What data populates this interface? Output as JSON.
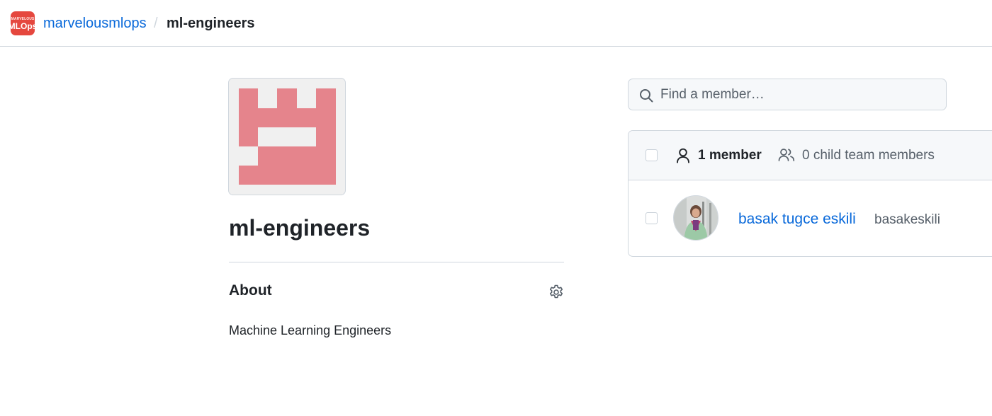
{
  "breadcrumb": {
    "org_logo": {
      "line1": "MARVELOUS",
      "line2": "MLOps"
    },
    "org": "marvelousmlops",
    "separator": "/",
    "team": "ml-engineers"
  },
  "team": {
    "name": "ml-engineers",
    "avatar_color": "#e5848c"
  },
  "about": {
    "heading": "About",
    "description": "Machine Learning Engineers",
    "settings_icon": "gear-icon"
  },
  "search": {
    "placeholder": "Find a member…",
    "icon": "search-icon"
  },
  "members": {
    "count_label": "1 member",
    "child_label": "0 child team members",
    "list": [
      {
        "name": "basak tugce eskili",
        "login": "basakeskili"
      }
    ]
  },
  "colors": {
    "link": "#0969da",
    "border": "#d0d7de",
    "header_bg": "#f6f8fa",
    "muted_text": "#57606a"
  }
}
